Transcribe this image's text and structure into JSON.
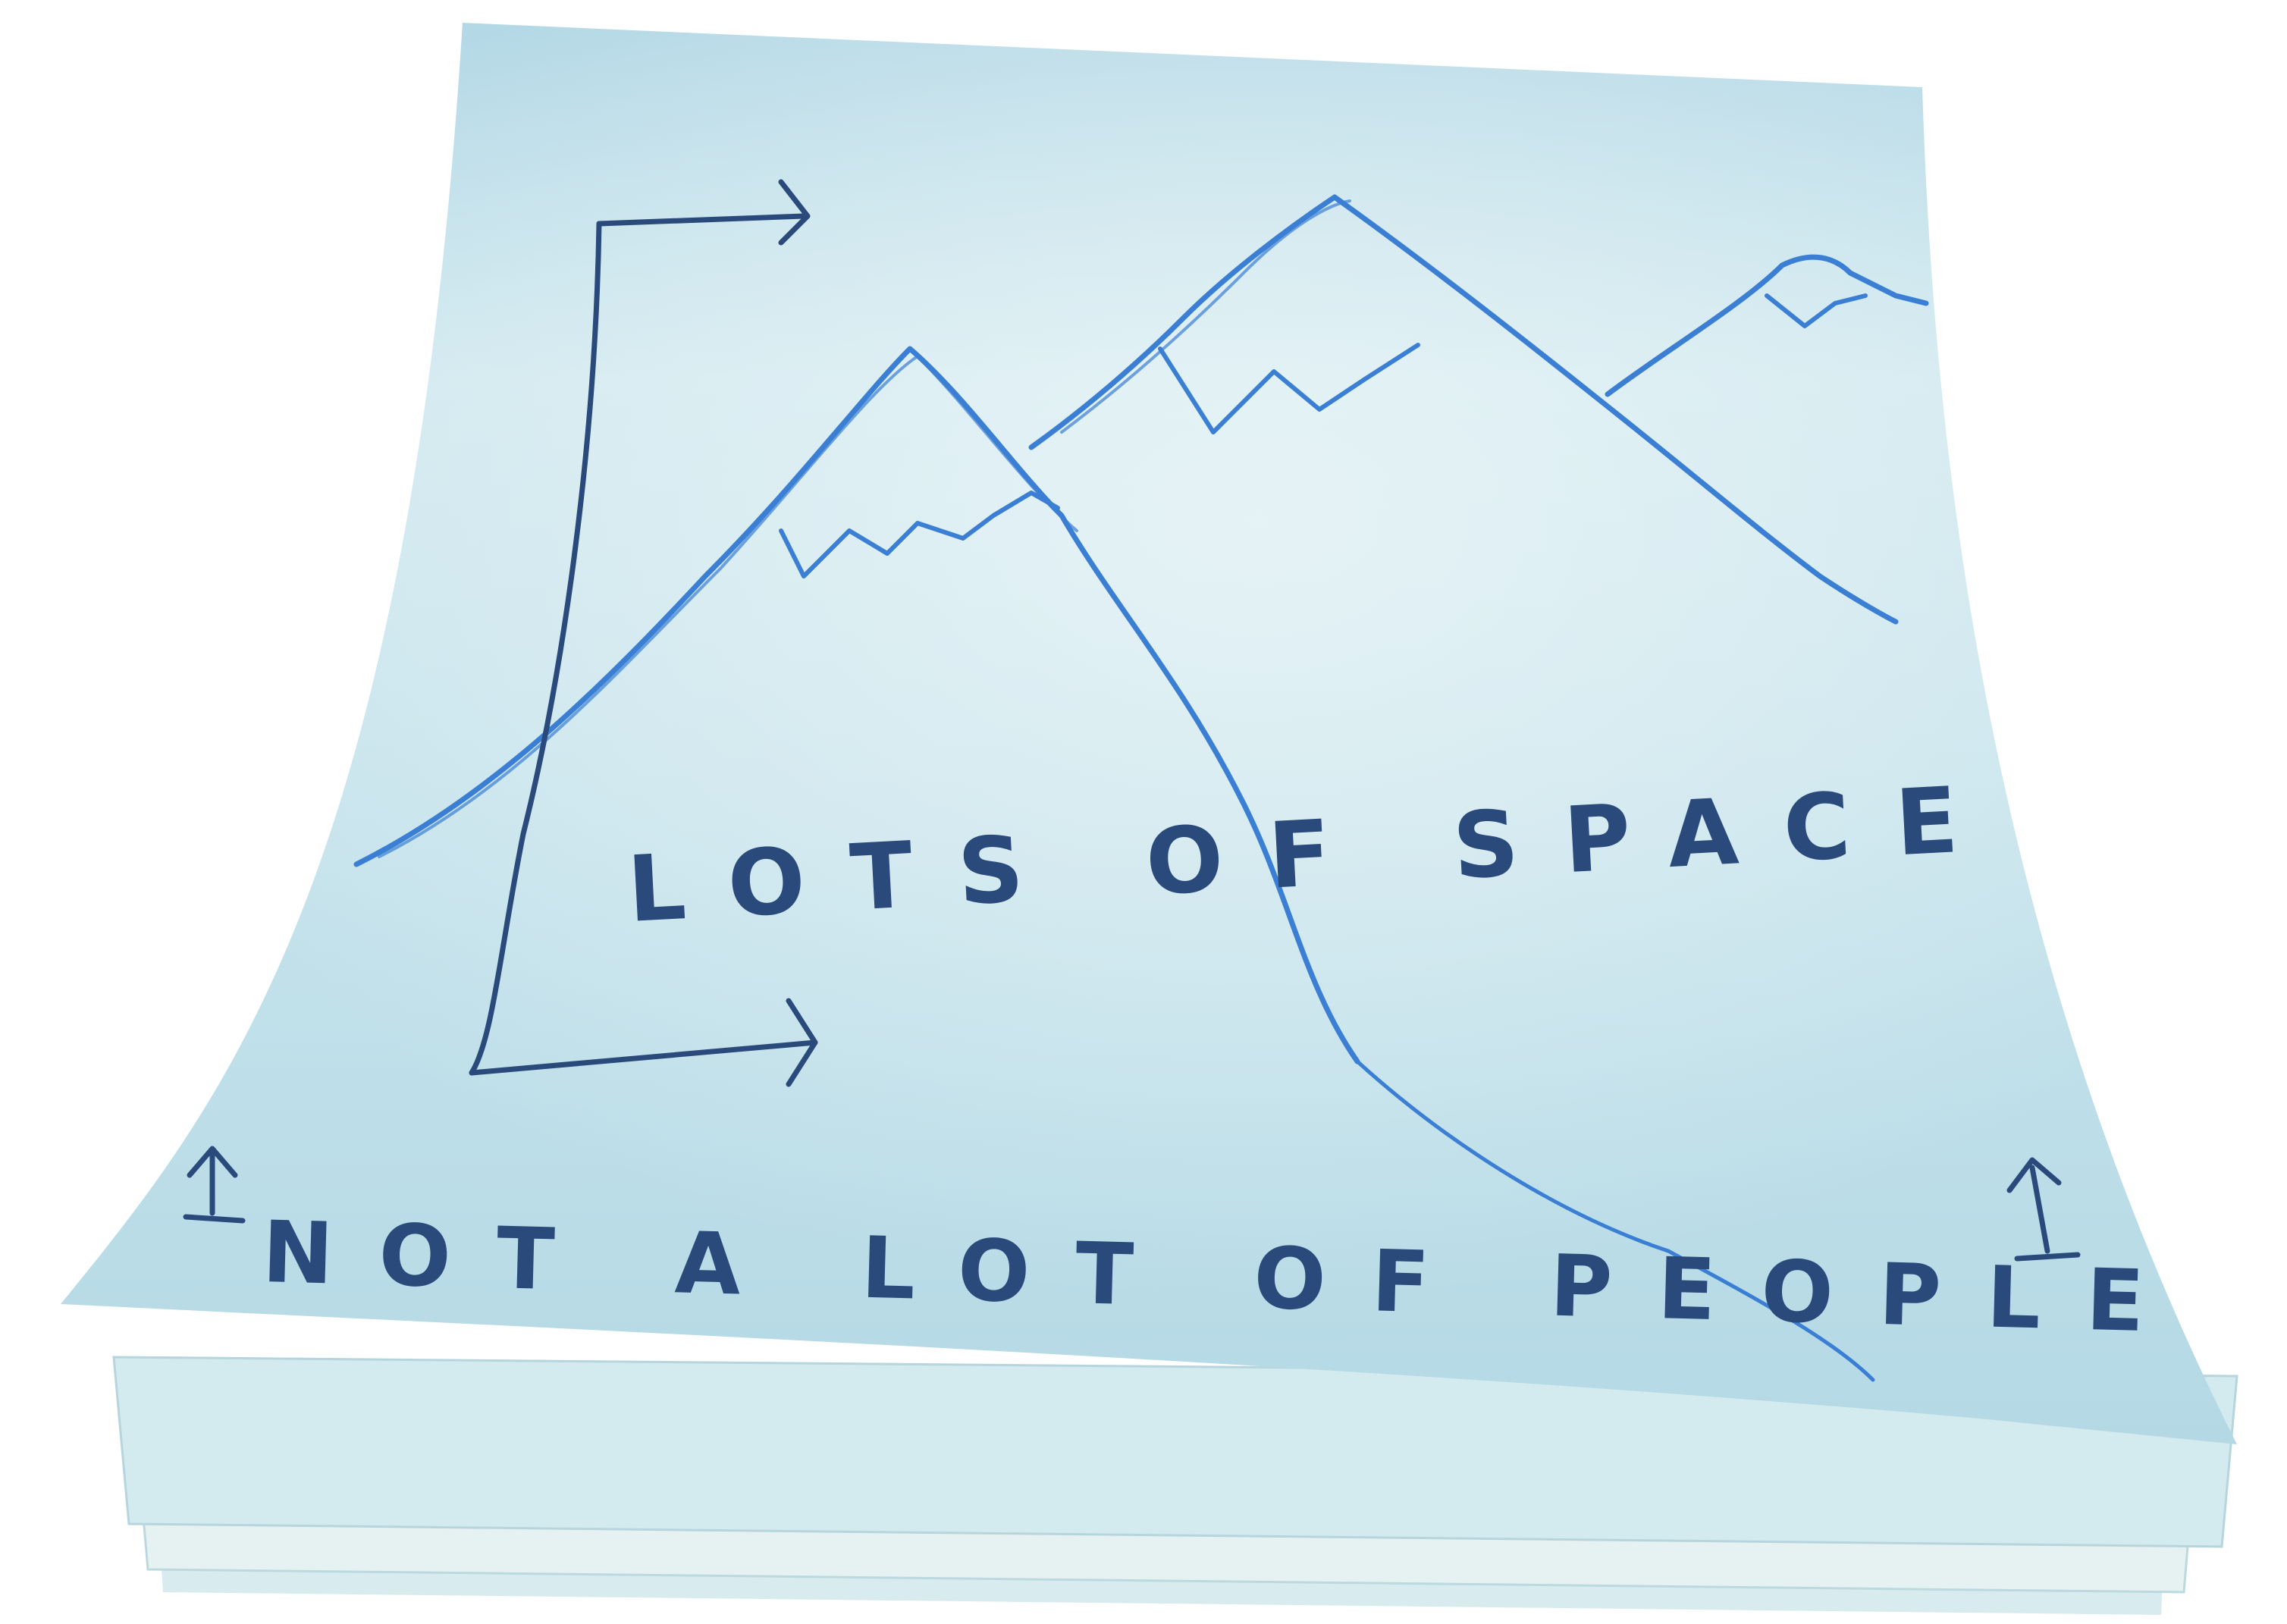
{
  "note": {
    "line1": "LOTS OF SPACE",
    "line2": "NOT A LOT OF PEOPLE"
  },
  "colors": {
    "paper": "#bfe0ec",
    "paper_light": "#e3f1f4",
    "mountain_ink": "#3b7fd4",
    "pen_ink": "#2a4a7c",
    "background": "#ffffff"
  }
}
